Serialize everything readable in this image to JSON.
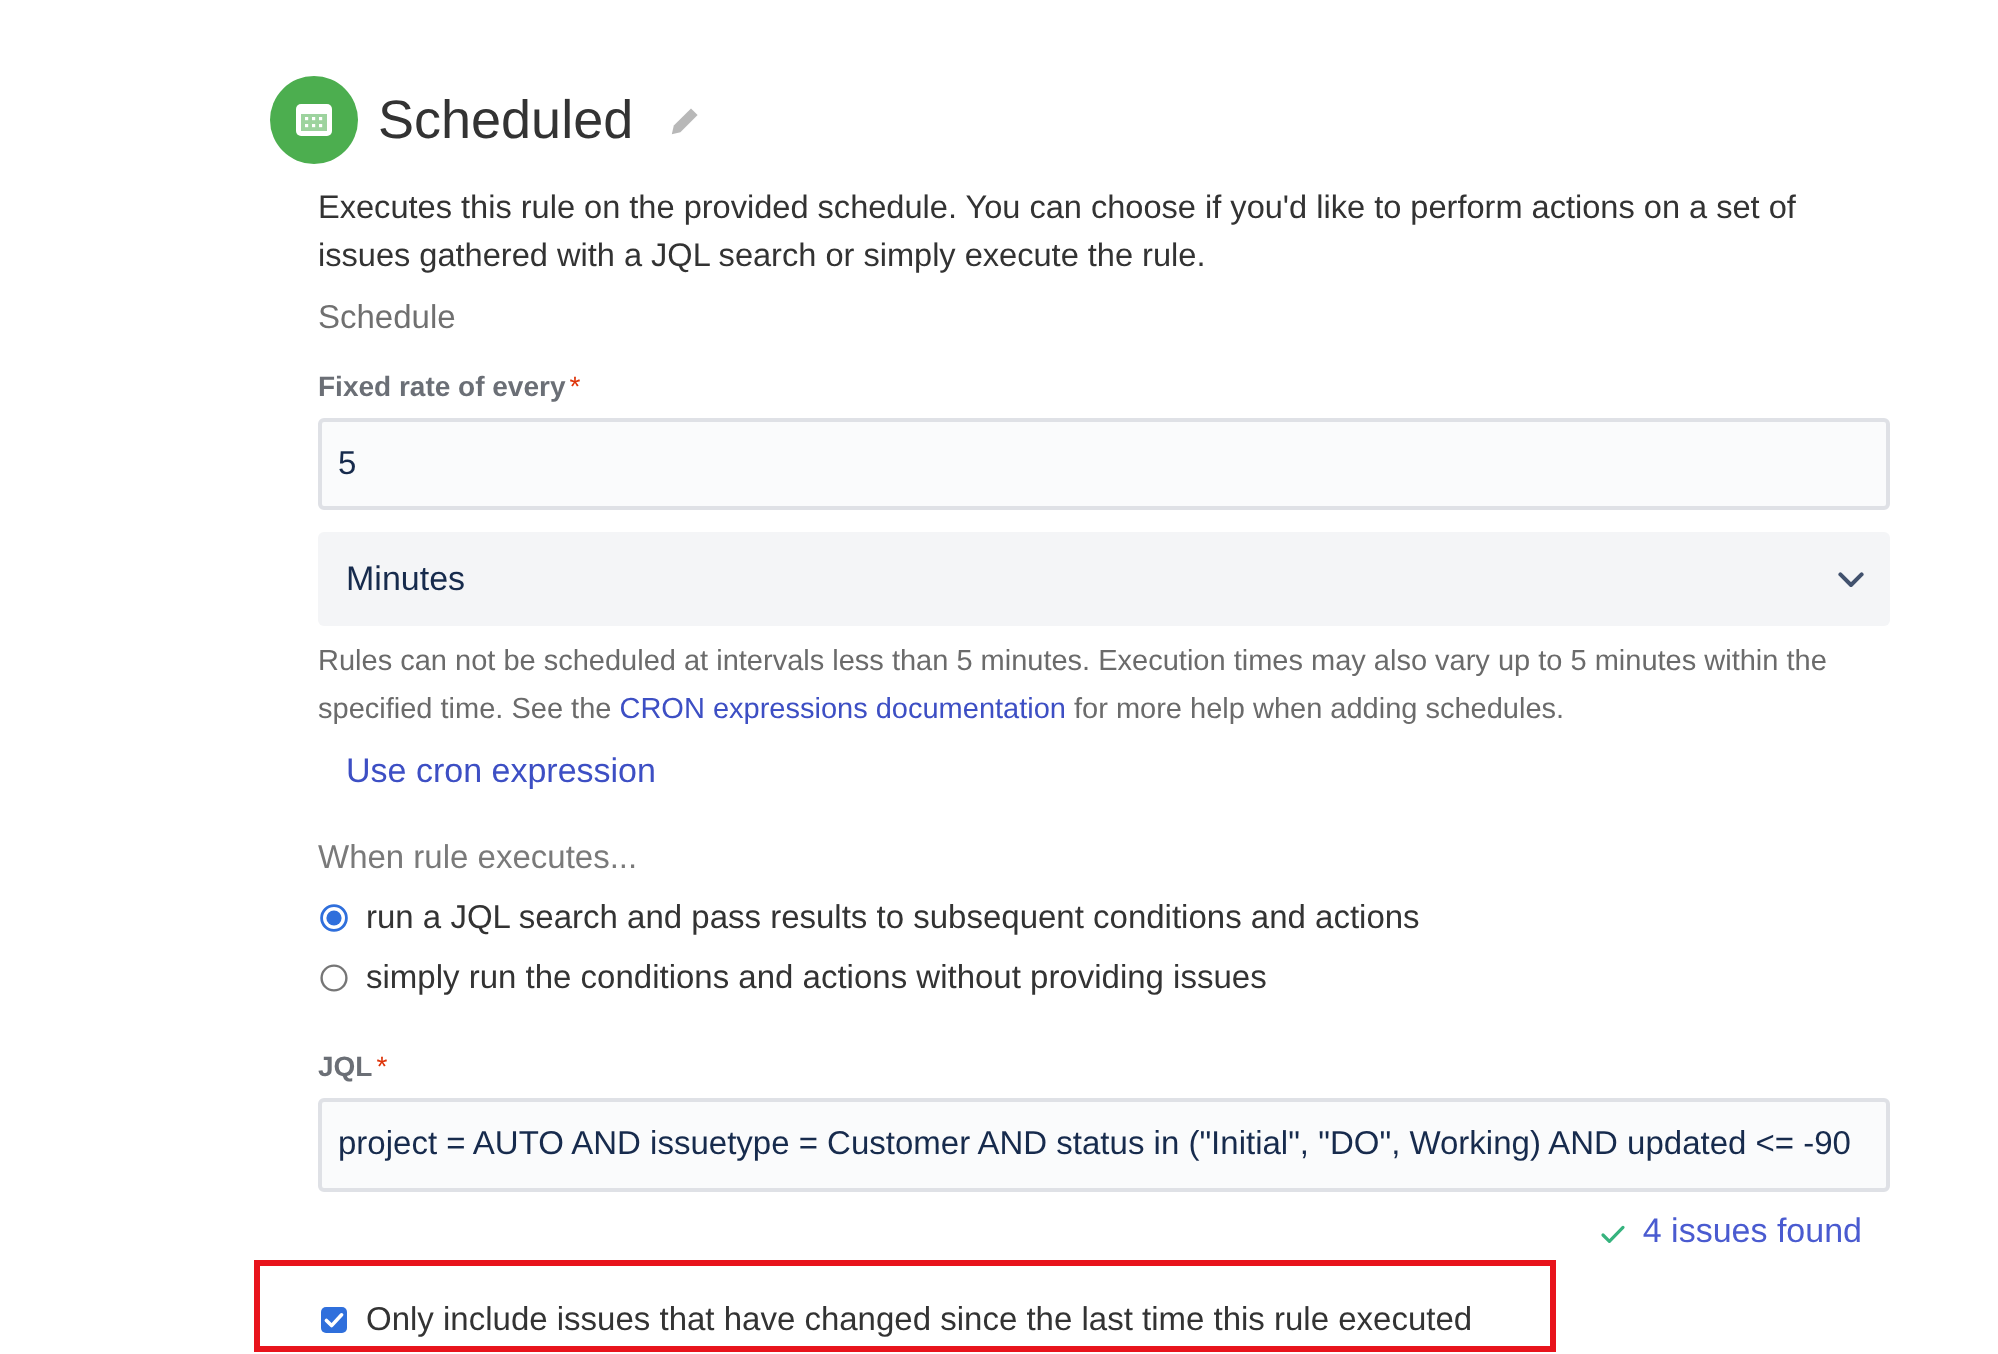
{
  "header": {
    "title": "Scheduled"
  },
  "description": "Executes this rule on the provided schedule. You can choose if you'd like to perform actions on a set of issues gathered with a JQL search or simply execute the rule.",
  "section_label": "Schedule",
  "rate_field": {
    "label": "Fixed rate of every",
    "required_mark": "*",
    "value": "5"
  },
  "unit_select": {
    "value": "Minutes"
  },
  "help_text": {
    "before": "Rules can not be scheduled at intervals less than 5 minutes. Execution times may also vary up to 5 minutes within the specified time. See the ",
    "link": "CRON expressions documentation",
    "after": " for more help when adding schedules."
  },
  "cron_link": "Use cron expression",
  "executes_label": "When rule executes...",
  "options": [
    {
      "label": "run a JQL search and pass results to subsequent conditions and actions",
      "selected": true
    },
    {
      "label": "simply run the conditions and actions without providing issues",
      "selected": false
    }
  ],
  "jql_field": {
    "label": "JQL",
    "required_mark": "*",
    "value": "project = AUTO AND issuetype = Customer AND status in (\"Initial\", \"DO\", Working) AND updated <= -90"
  },
  "validation": {
    "valid": true,
    "text": "4 issues found"
  },
  "only_changed": {
    "label": "Only include issues that have changed since the last time this rule executed",
    "checked": true,
    "highlighted": true
  }
}
